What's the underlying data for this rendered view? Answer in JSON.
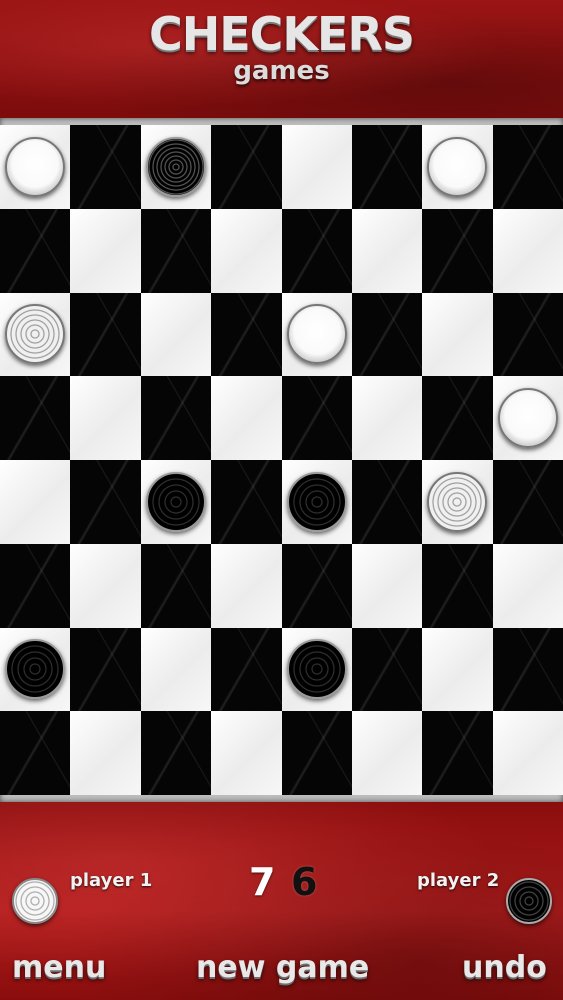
{
  "header": {
    "title": "CHECKERS",
    "subtitle": "games"
  },
  "board": {
    "size": 8,
    "top_left_square": "light",
    "pieces": [
      {
        "row": 0,
        "col": 0,
        "color": "white",
        "king": false
      },
      {
        "row": 0,
        "col": 2,
        "color": "black",
        "king": true
      },
      {
        "row": 0,
        "col": 6,
        "color": "white",
        "king": false
      },
      {
        "row": 2,
        "col": 0,
        "color": "white",
        "king": true
      },
      {
        "row": 2,
        "col": 4,
        "color": "white",
        "king": false
      },
      {
        "row": 3,
        "col": 7,
        "color": "white",
        "king": false
      },
      {
        "row": 4,
        "col": 2,
        "color": "black",
        "king": false
      },
      {
        "row": 4,
        "col": 4,
        "color": "black",
        "king": false
      },
      {
        "row": 4,
        "col": 6,
        "color": "white",
        "king": true
      },
      {
        "row": 6,
        "col": 0,
        "color": "black",
        "king": false
      },
      {
        "row": 6,
        "col": 4,
        "color": "black",
        "king": false
      }
    ]
  },
  "footer": {
    "player1_label": "player 1",
    "player2_label": "player 2",
    "player1_score": "7",
    "player2_score": "6",
    "menu_label": "menu",
    "new_game_label": "new game",
    "undo_label": "undo",
    "player1_piece": "white",
    "player2_piece": "black"
  },
  "colors": {
    "header_red": "#9a1414",
    "footer_red": "#b01c1c",
    "light_square": "#ffffff",
    "dark_square": "#050505"
  }
}
